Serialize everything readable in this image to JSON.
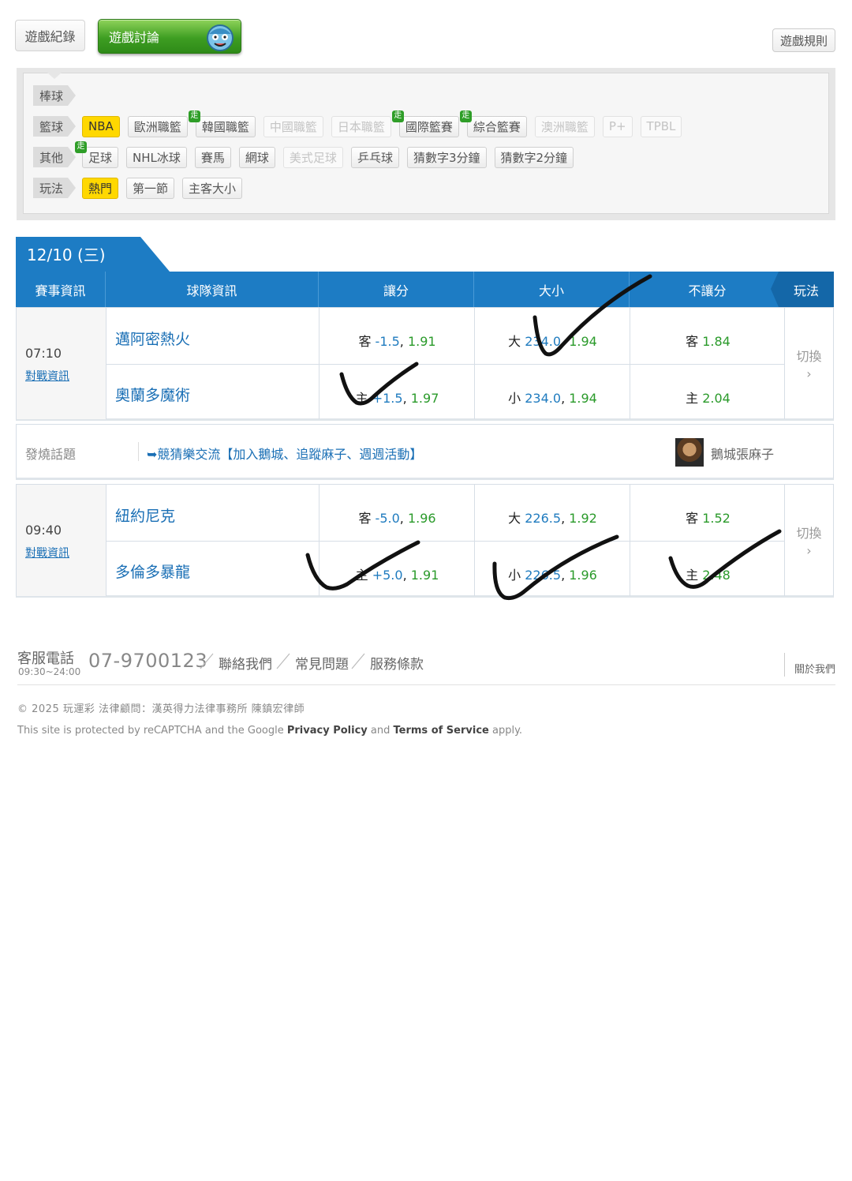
{
  "topbar": {
    "record_label": "遊戲紀錄",
    "discuss_label": "遊戲討論",
    "rules_label": "遊戲規則"
  },
  "filters": {
    "baseball": {
      "category": "棒球"
    },
    "basketball": {
      "category": "籃球",
      "items": [
        {
          "label": "NBA"
        },
        {
          "label": "歐洲職籃"
        },
        {
          "label": "韓國職籃",
          "badge": "走"
        },
        {
          "label": "中國職籃"
        },
        {
          "label": "日本職籃"
        },
        {
          "label": "國際籃賽",
          "badge": "走"
        },
        {
          "label": "綜合籃賽",
          "badge": "走"
        },
        {
          "label": "澳洲職籃"
        },
        {
          "label": "P+"
        },
        {
          "label": "TPBL"
        }
      ]
    },
    "other": {
      "category": "其他",
      "items": [
        {
          "label": "足球",
          "badge": "走"
        },
        {
          "label": "NHL冰球"
        },
        {
          "label": "賽馬"
        },
        {
          "label": "網球"
        },
        {
          "label": "美式足球"
        },
        {
          "label": "乒乓球"
        },
        {
          "label": "猜數字3分鐘"
        },
        {
          "label": "猜數字2分鐘"
        }
      ]
    },
    "play": {
      "category": "玩法",
      "items": [
        {
          "label": "熱門"
        },
        {
          "label": "第一節"
        },
        {
          "label": "主客大小"
        }
      ]
    }
  },
  "date_tab": "12/10 (三)",
  "table": {
    "headers": {
      "event": "賽事資訊",
      "team": "球隊資訊",
      "spread": "讓分",
      "total": "大小",
      "moneyline": "不讓分",
      "play": "玩法"
    },
    "games": [
      {
        "time": "07:10",
        "vs_link": "對戰資訊",
        "switch": "切換",
        "rows": [
          {
            "team": "邁阿密熱火",
            "spread": {
              "side": "客",
              "line": "-1.5",
              "odds": "1.91"
            },
            "total": {
              "side": "大",
              "line": "234.0",
              "odds": "1.94"
            },
            "ml": {
              "side": "客",
              "odds": "1.84"
            }
          },
          {
            "team": "奧蘭多魔術",
            "spread": {
              "side": "主",
              "line": "+1.5",
              "odds": "1.97"
            },
            "total": {
              "side": "小",
              "line": "234.0",
              "odds": "1.94"
            },
            "ml": {
              "side": "主",
              "odds": "2.04"
            }
          }
        ]
      },
      {
        "time": "09:40",
        "vs_link": "對戰資訊",
        "switch": "切換",
        "rows": [
          {
            "team": "紐約尼克",
            "spread": {
              "side": "客",
              "line": "-5.0",
              "odds": "1.96"
            },
            "total": {
              "side": "大",
              "line": "226.5",
              "odds": "1.92"
            },
            "ml": {
              "side": "客",
              "odds": "1.52"
            }
          },
          {
            "team": "多倫多暴龍",
            "spread": {
              "side": "主",
              "line": "+5.0",
              "odds": "1.91"
            },
            "total": {
              "side": "小",
              "line": "226.5",
              "odds": "1.96"
            },
            "ml": {
              "side": "主",
              "odds": "2.48"
            }
          }
        ]
      }
    ],
    "hot_topic": {
      "label": "發燒話題",
      "link": "➥競猜樂交流【加入鵝城、追蹤麻子、週週活動】",
      "user": "鵝城張麻子"
    }
  },
  "footer": {
    "service_label": "客服電話",
    "service_hours": "09:30~24:00",
    "phone": "07-9700123",
    "links": [
      "聯絡我們",
      "常見問題",
      "服務條款"
    ],
    "about": "關於我們",
    "copyright": "© 2025 玩運彩 法律顧問：漢英得力法律事務所 陳鎮宏律師",
    "recaptcha_pre": "This site is protected by reCAPTCHA and the Google",
    "privacy": "Privacy Policy",
    "and": "and",
    "terms": "Terms of Service",
    "apply": "apply."
  },
  "colors": {
    "header_blue": "#1d7cc4",
    "odds_green": "#2a9a2a",
    "line_blue": "#1f7bbf",
    "active_chip": "#ffd800"
  }
}
